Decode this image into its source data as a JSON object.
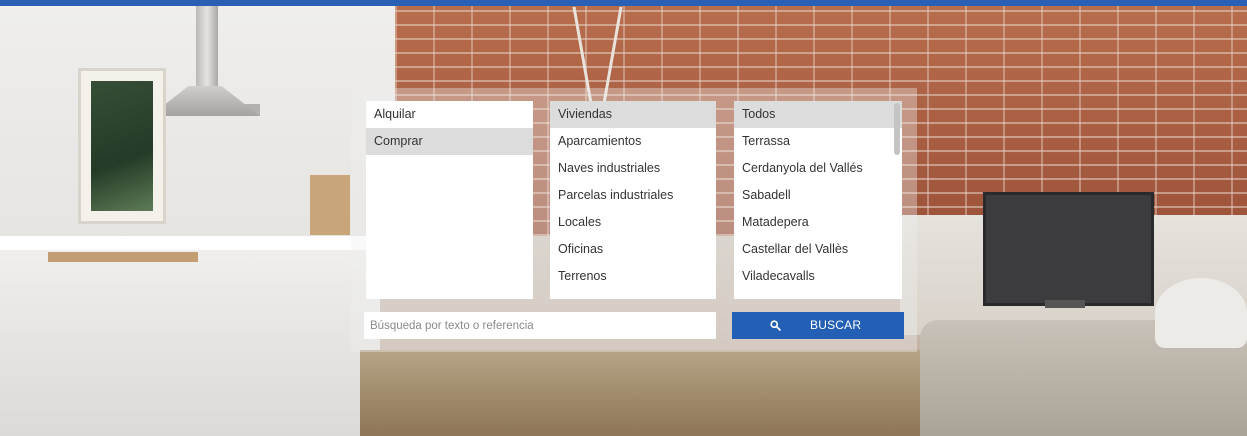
{
  "search_panel": {
    "operation": {
      "items": [
        "Alquilar",
        "Comprar"
      ],
      "selected": "Comprar"
    },
    "property_type": {
      "items": [
        "Viviendas",
        "Aparcamientos",
        "Naves industriales",
        "Parcelas industriales",
        "Locales",
        "Oficinas",
        "Terrenos"
      ],
      "selected": "Viviendas"
    },
    "city": {
      "items": [
        "Todos",
        "Terrassa",
        "Cerdanyola del Vallés",
        "Sabadell",
        "Matadepera",
        "Castellar del Vallès",
        "Viladecavalls"
      ],
      "selected": "Todos"
    },
    "text_search": {
      "placeholder": "Búsqueda por texto o referencia",
      "value": ""
    },
    "search_button": {
      "label": "BUSCAR",
      "icon": "search-icon"
    }
  },
  "colors": {
    "top_bar": "#2a5fb6",
    "button": "#2360b5",
    "selected_item": "#dcdcdc"
  }
}
